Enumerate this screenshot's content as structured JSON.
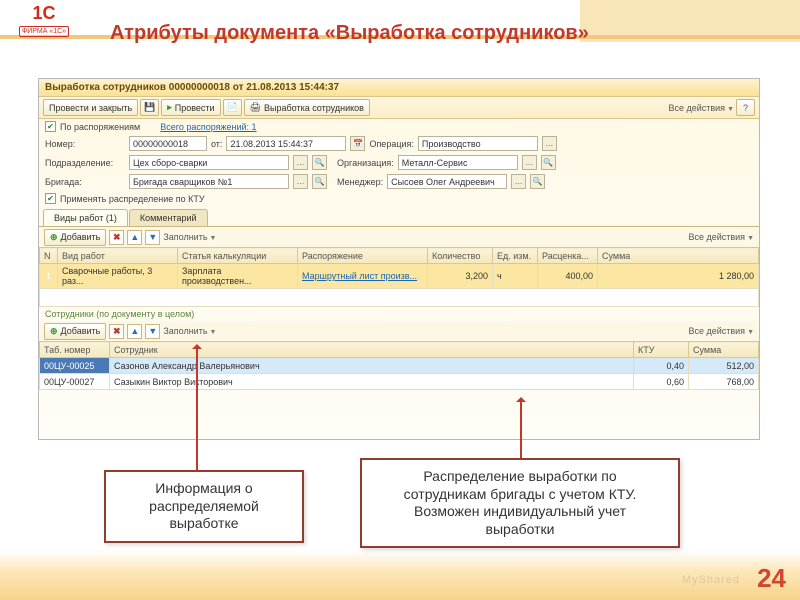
{
  "logo": {
    "brand": "1C",
    "sub": "ФИРМА «1С»"
  },
  "slide": {
    "title": "Атрибуты документа «Выработка сотрудников»",
    "num": "24",
    "watermark": "MyShared"
  },
  "win": {
    "title": "Выработка сотрудников 00000000018 от 21.08.2013 15:44:37",
    "toolbar": {
      "mainBtn": "Провести и закрыть",
      "post": "Провести",
      "printBtn": "Выработка сотрудников",
      "allActions": "Все действия"
    },
    "orders": {
      "chkLabel": "По распоряжениям",
      "link": "Всего распоряжений: 1"
    },
    "fields": {
      "numLbl": "Номер:",
      "numVal": "00000000018",
      "otLbl": "от:",
      "dateVal": "21.08.2013 15:44:37",
      "opLbl": "Операция:",
      "opVal": "Производство",
      "deptLbl": "Подразделение:",
      "deptVal": "Цех сборо-сварки",
      "orgLbl": "Организация:",
      "orgVal": "Металл-Сервис",
      "brigLbl": "Бригада:",
      "brigVal": "Бригада сварщиков №1",
      "mgrLbl": "Менеджер:",
      "mgrVal": "Сысоев Олег Андреевич",
      "ktuChk": "Применять распределение по КТУ"
    },
    "tabs": {
      "t1": "Виды работ (1)",
      "t2": "Комментарий"
    },
    "tableToolbar": {
      "add": "Добавить",
      "fill": "Заполнить"
    },
    "worksCols": {
      "n": "N",
      "kind": "Вид работ",
      "art": "Статья калькуляции",
      "order": "Распоряжение",
      "qty": "Количество",
      "unit": "Ед. изм.",
      "rate": "Расценка...",
      "sum": "Сумма"
    },
    "worksRow": {
      "n": "1",
      "kind": "Сварочные работы, 3 раз...",
      "art": "Зарплата производствен...",
      "order": "Маршрутный лист произв...",
      "qty": "3,200",
      "unit": "ч",
      "rate": "400,00",
      "sum": "1 280,00"
    },
    "empSection": "Сотрудники (по документу в целом)",
    "empCols": {
      "tab": "Таб. номер",
      "name": "Сотрудник",
      "ktu": "КТУ",
      "sum": "Сумма"
    },
    "empRows": [
      {
        "tab": "00ЦУ-00025",
        "name": "Сазонов Александр Валерьянович",
        "ktu": "0,40",
        "sum": "512,00"
      },
      {
        "tab": "00ЦУ-00027",
        "name": "Сазыкин Виктор Викторович",
        "ktu": "0,60",
        "sum": "768,00"
      }
    ]
  },
  "callouts": {
    "c1": "Информация о\nраспределяемой\nвыработке",
    "c2": "Распределение выработки по\nсотрудникам бригады с учетом КТУ.\nВозможен индивидуальный учет\nвыработки"
  }
}
